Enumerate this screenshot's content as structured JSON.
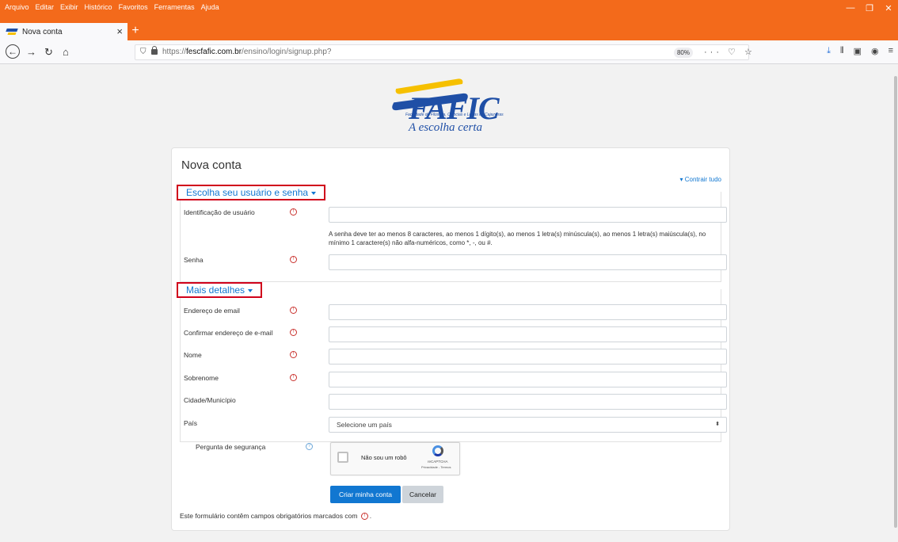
{
  "browser": {
    "menu": [
      "Arquivo",
      "Editar",
      "Exibir",
      "Histórico",
      "Favoritos",
      "Ferramentas",
      "Ajuda"
    ],
    "tab_title": "Nova conta",
    "url_prefix": "https://",
    "url_domain": "fescfafic.com.br",
    "url_path": "/ensino/login/signup.php?",
    "zoom": "80%",
    "urlbar_icons": "··· ♡ ☆"
  },
  "logo": {
    "brand": "FAFIC",
    "subtitle": "Faculdade de Filosofia, Ciências e Letras de Cajazeiras",
    "tagline": "A escolha certa"
  },
  "form": {
    "title": "Nova conta",
    "collapse_all": "Contrair tudo",
    "section1_label": "Escolha seu usuário e senha",
    "section2_label": "Mais detalhes",
    "fields": {
      "username": "Identificação de usuário",
      "password_hint": "A senha deve ter ao menos 8 caracteres, ao menos 1 dígito(s), ao menos 1 letra(s) minúscula(s), ao menos 1 letra(s) maiúscula(s), no mínimo 1 caractere(s) não alfa-numéricos, como *, -, ou #.",
      "password": "Senha",
      "email": "Endereço de email",
      "email_confirm": "Confirmar endereço de e-mail",
      "firstname": "Nome",
      "lastname": "Sobrenome",
      "city": "Cidade/Município",
      "country": "País",
      "country_placeholder": "Selecione um país",
      "security_question": "Pergunta de segurança"
    },
    "recaptcha": {
      "label": "Não sou um robô",
      "brand": "reCAPTCHA",
      "terms": "Privacidade - Termos"
    },
    "submit_label": "Criar minha conta",
    "cancel_label": "Cancelar",
    "footer_note": "Este formulário contêm campos obrigatórios marcados com",
    "footer_end": "."
  }
}
